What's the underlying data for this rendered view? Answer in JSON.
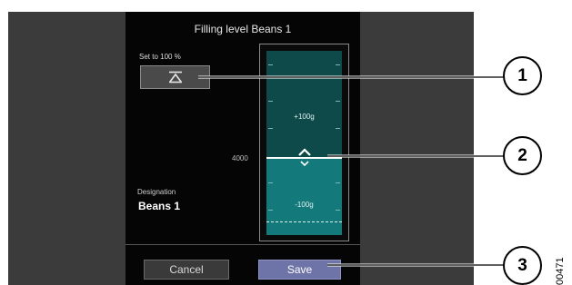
{
  "dialog": {
    "title": "Filling level Beans 1",
    "set_to_100_label": "Set to 100 %",
    "set_to_100_icon": "fill-to-top-icon",
    "level_value": "4000",
    "designation_label": "Designation",
    "designation_value": "Beans 1"
  },
  "gauge": {
    "plus_label": "+100g",
    "minus_label": "-100g",
    "handle_icon": "up-down-chevron-icon",
    "upper_color": "#0f4a4a",
    "lower_color": "#13797a"
  },
  "buttons": {
    "cancel_label": "Cancel",
    "save_label": "Save",
    "save_color": "#6f74a8"
  },
  "callouts": [
    "1",
    "2",
    "3"
  ],
  "figure_id": "00471"
}
